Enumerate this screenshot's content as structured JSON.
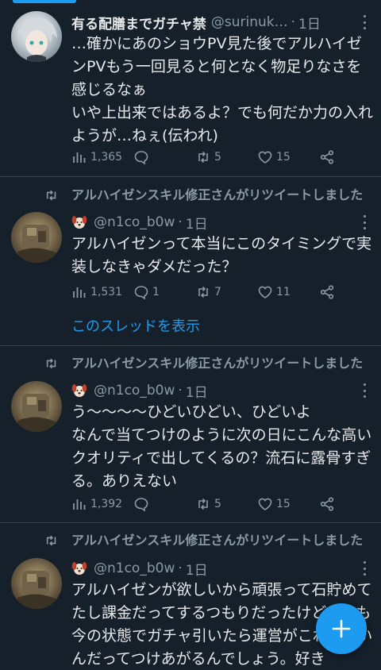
{
  "tweets": [
    {
      "name": "有る配膳までガチャ禁",
      "handle": "@surinuk…",
      "sep": "·",
      "time": "1日",
      "body": "…確かにあのショウPV見た後でアルハイゼンPVもう一回見ると何となく物足りなさを感じるなぁ\nいや上出来ではあるよ？でも何だか力の入れようが…ねぇ(伝われ)",
      "views": "1,365",
      "replies": "",
      "retweets": "5",
      "likes": "15"
    },
    {
      "retweet_label": "アルハイゼンスキル修正さんがリツイートしました",
      "handle": "@n1co_b0w",
      "sep": "·",
      "time": "1日",
      "body": "アルハイゼンって本当にこのタイミングで実装しなきゃダメだった？",
      "views": "1,531",
      "replies": "1",
      "retweets": "7",
      "likes": "11",
      "show_thread": "このスレッドを表示"
    },
    {
      "retweet_label": "アルハイゼンスキル修正さんがリツイートしました",
      "handle": "@n1co_b0w",
      "sep": "·",
      "time": "1日",
      "body": "う〜〜〜〜ひどいひどい、ひどいよ\nなんで当てつけのように次の日にこんな高いクオリティで出してくるの？流石に露骨すぎる。ありえない",
      "views": "1,392",
      "replies": "",
      "retweets": "5",
      "likes": "15"
    },
    {
      "retweet_label": "アルハイゼンスキル修正さんがリツイートしました",
      "handle": "@n1co_b0w",
      "sep": "·",
      "time": "1日",
      "body": "アルハイゼンが欲しいから頑張って石貯めてたし課金だってするつもりだったけど、でも今の状態でガチャ引いたら運営がこれでいいんだってつけあがるんでしょう。好き"
    }
  ],
  "icons": {
    "views": "bar-chart-icon",
    "reply": "speech-bubble-icon",
    "retweet": "retweet-icon",
    "like": "heart-icon",
    "share": "share-icon",
    "fab": "plus-icon",
    "dog": "dog-face-emoji"
  },
  "colors": {
    "background": "#15202b",
    "accent": "#1d9bf0",
    "muted": "#8b98a5",
    "text": "#e7e9ea",
    "divider": "#38444d"
  }
}
